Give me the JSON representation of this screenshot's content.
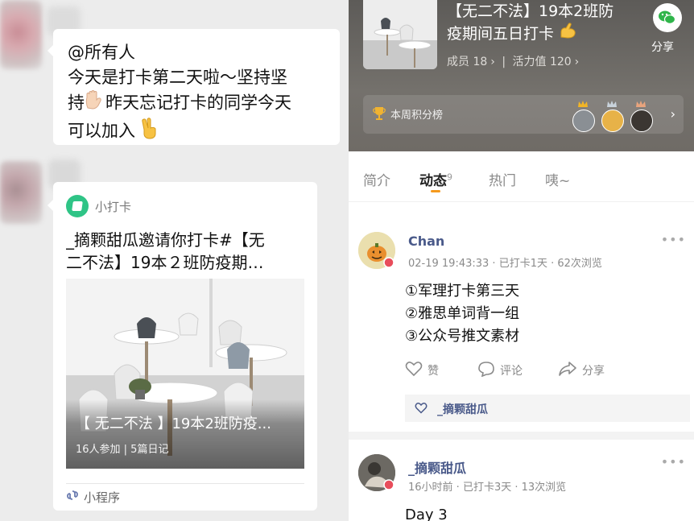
{
  "chat": {
    "message_lines": [
      "@所有人",
      "今天是打卡第二天啦～坚持坚",
      "持",
      "昨天忘记打卡的同学今天",
      "可以加入"
    ],
    "mini_program_card": {
      "source": "小打卡",
      "title_lines": [
        "_摘颗甜瓜邀请你打卡#【无",
        "二不法】19本２班防疫期…"
      ],
      "image_title": "【 无二不法 】19本2班防疫...",
      "image_meta": "16人参加 | 5篇日记",
      "footer_label": "小程序"
    }
  },
  "group": {
    "title_lines": [
      "【无二不法】19本2班防",
      "疫期间五日打卡"
    ],
    "members": "成员 18",
    "activity": "活力值 120",
    "share_label": "分享",
    "rank_label": "本周积分榜",
    "tabs": [
      {
        "label": "简介",
        "badge": ""
      },
      {
        "label": "动态",
        "badge": "9"
      },
      {
        "label": "热门",
        "badge": ""
      },
      {
        "label": "咦~",
        "badge": ""
      }
    ],
    "active_tab": "动态",
    "accent_color": "#f59a1d"
  },
  "posts": [
    {
      "author": "Chan",
      "time": "02-19 19:43:33",
      "checked_in": "已打卡1天",
      "views": "62次浏览",
      "body_lines": [
        "①军理打卡第三天",
        "②雅思单词背一组",
        "③公众号推文素材"
      ],
      "like_label": "赞",
      "comment_label": "评论",
      "share_label": "分享",
      "liked_by": "_摘颗甜瓜"
    },
    {
      "author": "_摘颗甜瓜",
      "time": "16小时前",
      "checked_in": "已打卡3天",
      "views": "13次浏览",
      "body_lines": [
        "Day 3"
      ]
    }
  ]
}
